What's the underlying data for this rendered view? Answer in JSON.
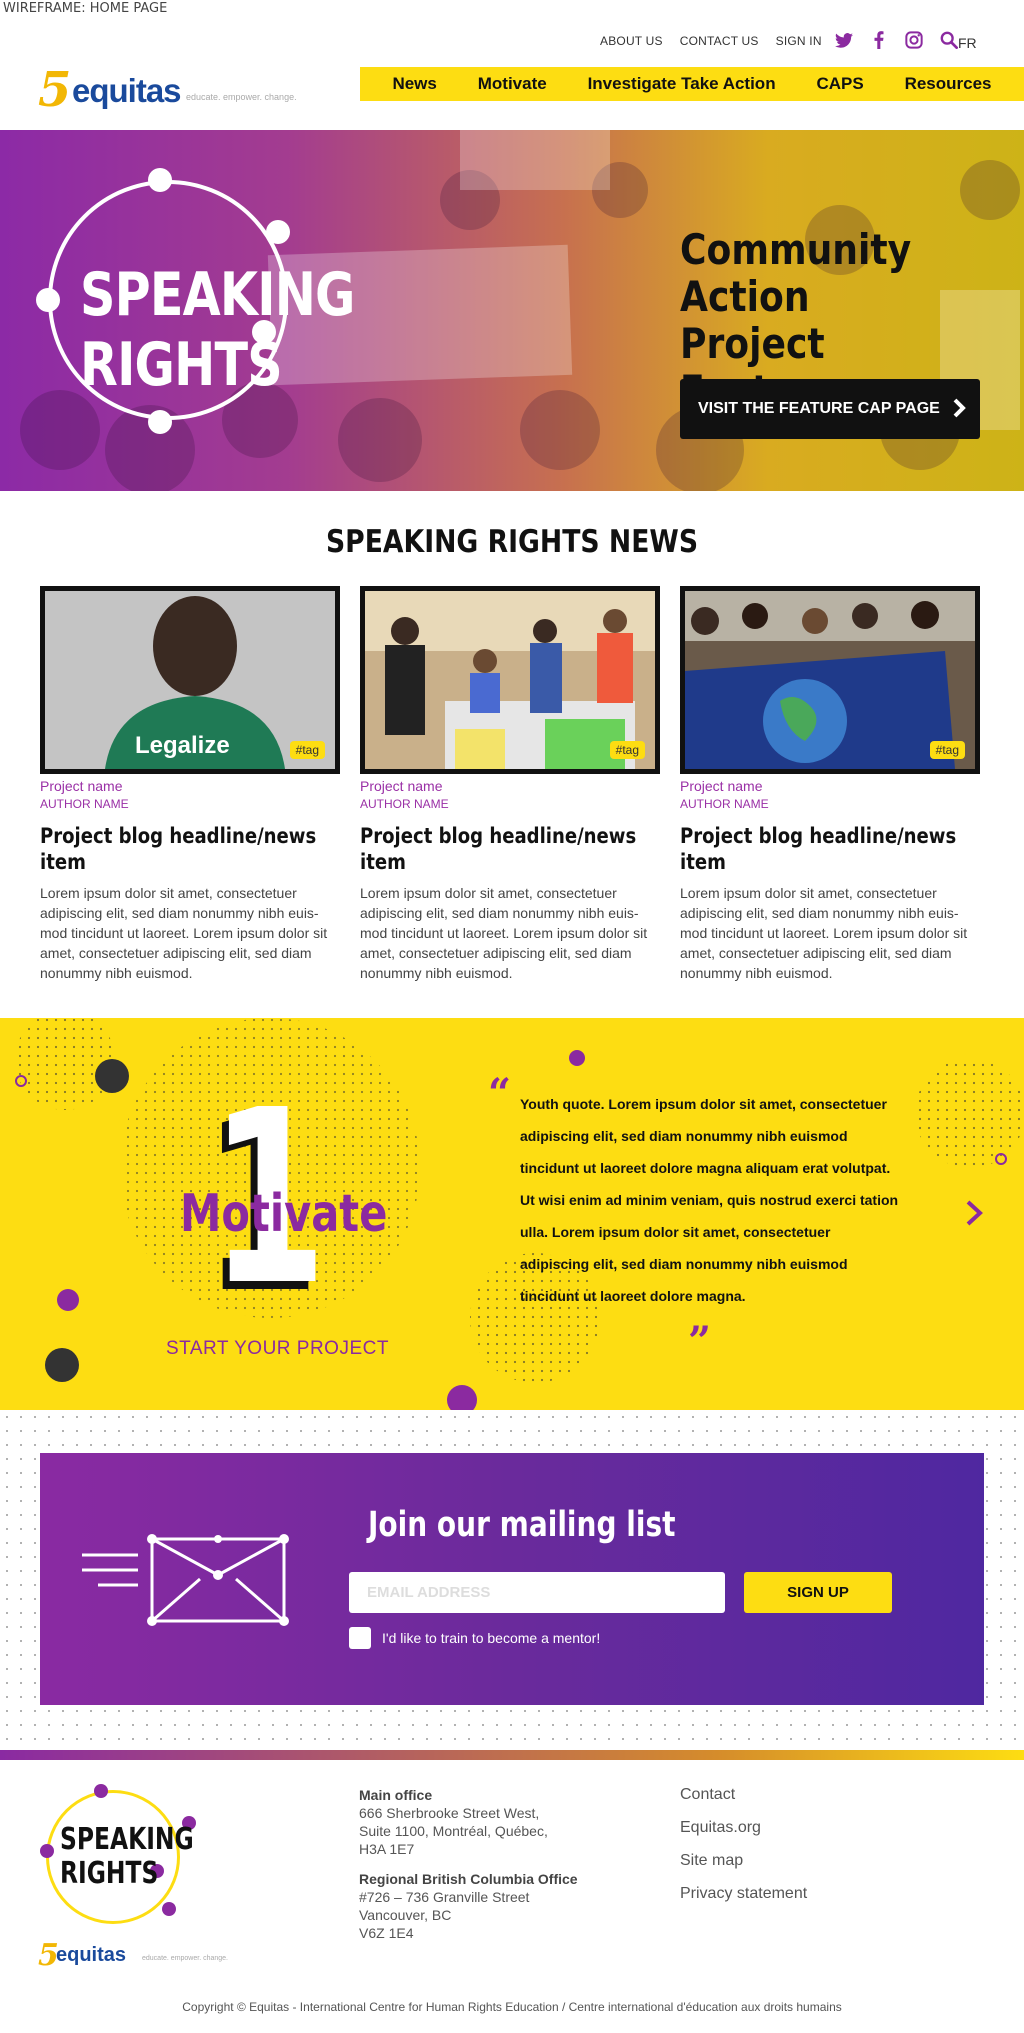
{
  "wireframe_label": "WIREFRAME: HOME PAGE",
  "header": {
    "top_links": [
      "ABOUT US",
      "CONTACT US",
      "SIGN IN"
    ],
    "social_icons": [
      "twitter-icon",
      "facebook-icon",
      "instagram-icon",
      "search-icon"
    ],
    "lang": "FR",
    "logo": {
      "five": "5",
      "word": "equitas",
      "tagline": "educate. empower. change."
    },
    "nav": [
      "News",
      "Motivate",
      "Investigate Take Action",
      "CAPS",
      "Resources"
    ]
  },
  "hero": {
    "logo_line1": "SPEAKING",
    "logo_line2": "RIGHTS",
    "feature_title": "Community Action Project Feature",
    "feature_button": "VISIT THE FEATURE CAP PAGE"
  },
  "news": {
    "title": "SPEAKING RIGHTS NEWS",
    "cards": [
      {
        "tag": "#tag",
        "project": "Project name",
        "author": "AUTHOR NAME",
        "headline": "Project blog headline/news item",
        "body": "Lorem ipsum dolor sit amet, consectetuer adipiscing elit, sed diam nonummy nibh euis-mod tincidunt ut laoreet. Lorem ipsum dolor sit amet, consectetuer adipiscing elit, sed diam nonummy nibh euismod."
      },
      {
        "tag": "#tag",
        "project": "Project name",
        "author": "AUTHOR NAME",
        "headline": "Project blog headline/news item",
        "body": "Lorem ipsum dolor sit amet, consectetuer adipiscing elit, sed diam nonummy nibh euis-mod tincidunt ut laoreet. Lorem ipsum dolor sit amet, consectetuer adipiscing elit, sed diam nonummy nibh euismod."
      },
      {
        "tag": "#tag",
        "project": "Project name",
        "author": "AUTHOR NAME",
        "headline": "Project blog headline/news item",
        "body": "Lorem ipsum dolor sit amet, consectetuer adipiscing elit, sed diam nonummy nibh euis-mod tincidunt ut laoreet. Lorem ipsum dolor sit amet, consectetuer adipiscing elit, sed diam nonummy nibh euismod."
      }
    ]
  },
  "motivate": {
    "number": "1",
    "word": "Motivate",
    "cta": "START YOUR PROJECT",
    "quote": "Youth quote. Lorem ipsum dolor sit amet, consectetuer adipiscing elit, sed diam nonummy nibh euismod tincidunt ut laoreet dolore magna aliquam erat volutpat. Ut wisi enim ad minim veniam, quis nostrud exerci tation ulla. Lorem ipsum dolor sit amet, consectetuer adipiscing elit, sed diam nonummy nibh euismod tincidunt ut laoreet dolore magna."
  },
  "mailing": {
    "title": "Join our mailing list",
    "email_placeholder": "EMAIL ADDRESS",
    "signup": "SIGN UP",
    "mentor_label": "I'd like to train to become a mentor!"
  },
  "footer": {
    "logo_line1": "SPEAKING",
    "logo_line2": "RIGHTS",
    "small_logo": {
      "five": "5",
      "word": "equitas",
      "tagline": "educate. empower. change."
    },
    "main_office": {
      "label": "Main office",
      "lines": [
        "666 Sherbrooke Street West,",
        "Suite 1100, Montréal, Québec,",
        "H3A 1E7"
      ]
    },
    "bc_office": {
      "label": "Regional British Columbia Office",
      "lines": [
        "#726 – 736 Granville Street",
        "Vancouver, BC",
        "V6Z 1E4"
      ]
    },
    "links": [
      "Contact",
      "Equitas.org",
      "Site map",
      "Privacy statement"
    ],
    "copyright": "Copyright © Equitas - International Centre for Human Rights Education / Centre international d'éducation aux droits humains"
  },
  "colors": {
    "yellow": "#fddd12",
    "purple": "#8b2aa0",
    "navy": "#1a4a9c",
    "dark": "#111111"
  }
}
